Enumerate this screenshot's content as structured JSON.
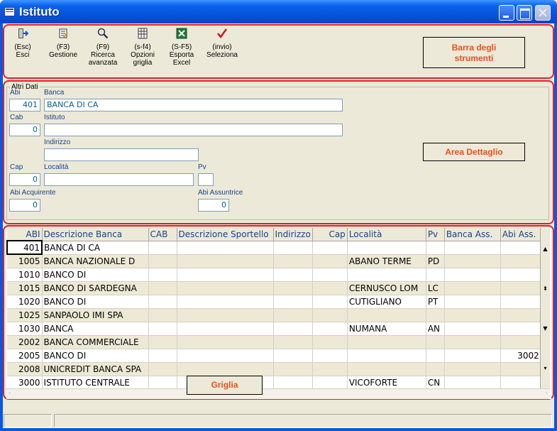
{
  "window": {
    "title": "Istituto"
  },
  "toolbar": {
    "items": [
      {
        "label": "(Esc)\nEsci",
        "icon": "exit-door-icon"
      },
      {
        "label": "(F3)\nGestione",
        "icon": "edit-document-icon"
      },
      {
        "label": "(F9)\nRicerca\navanzata",
        "icon": "search-magnifier-icon"
      },
      {
        "label": "(s-f4)\nOpzioni\ngriglia",
        "icon": "grid-options-icon"
      },
      {
        "label": "(S-F5)\nEsporta\nExcel",
        "icon": "excel-icon"
      },
      {
        "label": "(invio)\nSeleziona",
        "icon": "checkmark-icon"
      }
    ],
    "callout": "Barra degli\nstrumenti"
  },
  "detail": {
    "legend": "Altri Dati",
    "callout": "Area Dettaglio",
    "abi_label": "Abi",
    "abi_value": "401",
    "banca_label": "Banca",
    "banca_value": "BANCA DI CA",
    "cab_label": "Cab",
    "cab_value": "0",
    "istituto_label": "Istituto",
    "istituto_value": "",
    "indirizzo_label": "Indirizzo",
    "indirizzo_value": "",
    "cap_label": "Cap",
    "cap_value": "0",
    "localita_label": "Località",
    "localita_value": "",
    "pv_label": "Pv",
    "pv_value": "",
    "abi_acq_label": "Abi Acquirente",
    "abi_acq_value": "0",
    "abi_ass_label": "Abi Assuntrice",
    "abi_ass_value": "0"
  },
  "grid": {
    "callout": "Griglia",
    "columns": [
      "ABI",
      "Descrizione Banca",
      "CAB",
      "Descrizione Sportello",
      "Indirizzo",
      "Cap",
      "Località",
      "Pv",
      "Banca Ass.",
      "Abi Ass."
    ],
    "rows": [
      [
        "401",
        "BANCA DI CA",
        "",
        "",
        "",
        "",
        "",
        "",
        "",
        ""
      ],
      [
        "1005",
        "BANCA NAZIONALE D",
        "",
        "",
        "",
        "",
        "ABANO TERME",
        "PD",
        "",
        ""
      ],
      [
        "1010",
        "BANCO DI",
        "",
        "",
        "",
        "",
        "",
        "",
        "",
        ""
      ],
      [
        "1015",
        "BANCO DI SARDEGNA",
        "",
        "",
        "",
        "",
        "CERNUSCO LOM",
        "LC",
        "",
        ""
      ],
      [
        "1020",
        "BANCO DI",
        "",
        "",
        "",
        "",
        "CUTIGLIANO",
        "PT",
        "",
        ""
      ],
      [
        "1025",
        "SANPAOLO IMI SPA",
        "",
        "",
        "",
        "",
        "",
        "",
        "",
        ""
      ],
      [
        "1030",
        "BANCA",
        "",
        "",
        "",
        "",
        "NUMANA",
        "AN",
        "",
        ""
      ],
      [
        "2002",
        "BANCA COMMERCIALE",
        "",
        "",
        "",
        "",
        "",
        "",
        "",
        ""
      ],
      [
        "2005",
        "BANCO DI",
        "",
        "",
        "",
        "",
        "",
        "",
        "",
        "3002"
      ],
      [
        "2008",
        "UNICREDIT BANCA SPA",
        "",
        "",
        "",
        "",
        "",
        "",
        "",
        ""
      ],
      [
        "3000",
        "ISTITUTO CENTRALE",
        "",
        "",
        "",
        "",
        "VICOFORTE",
        "CN",
        "",
        ""
      ]
    ]
  },
  "colors": {
    "accent_red": "#e2202a",
    "callout_text": "#e8501b",
    "titlebar": "#0b61ec"
  }
}
